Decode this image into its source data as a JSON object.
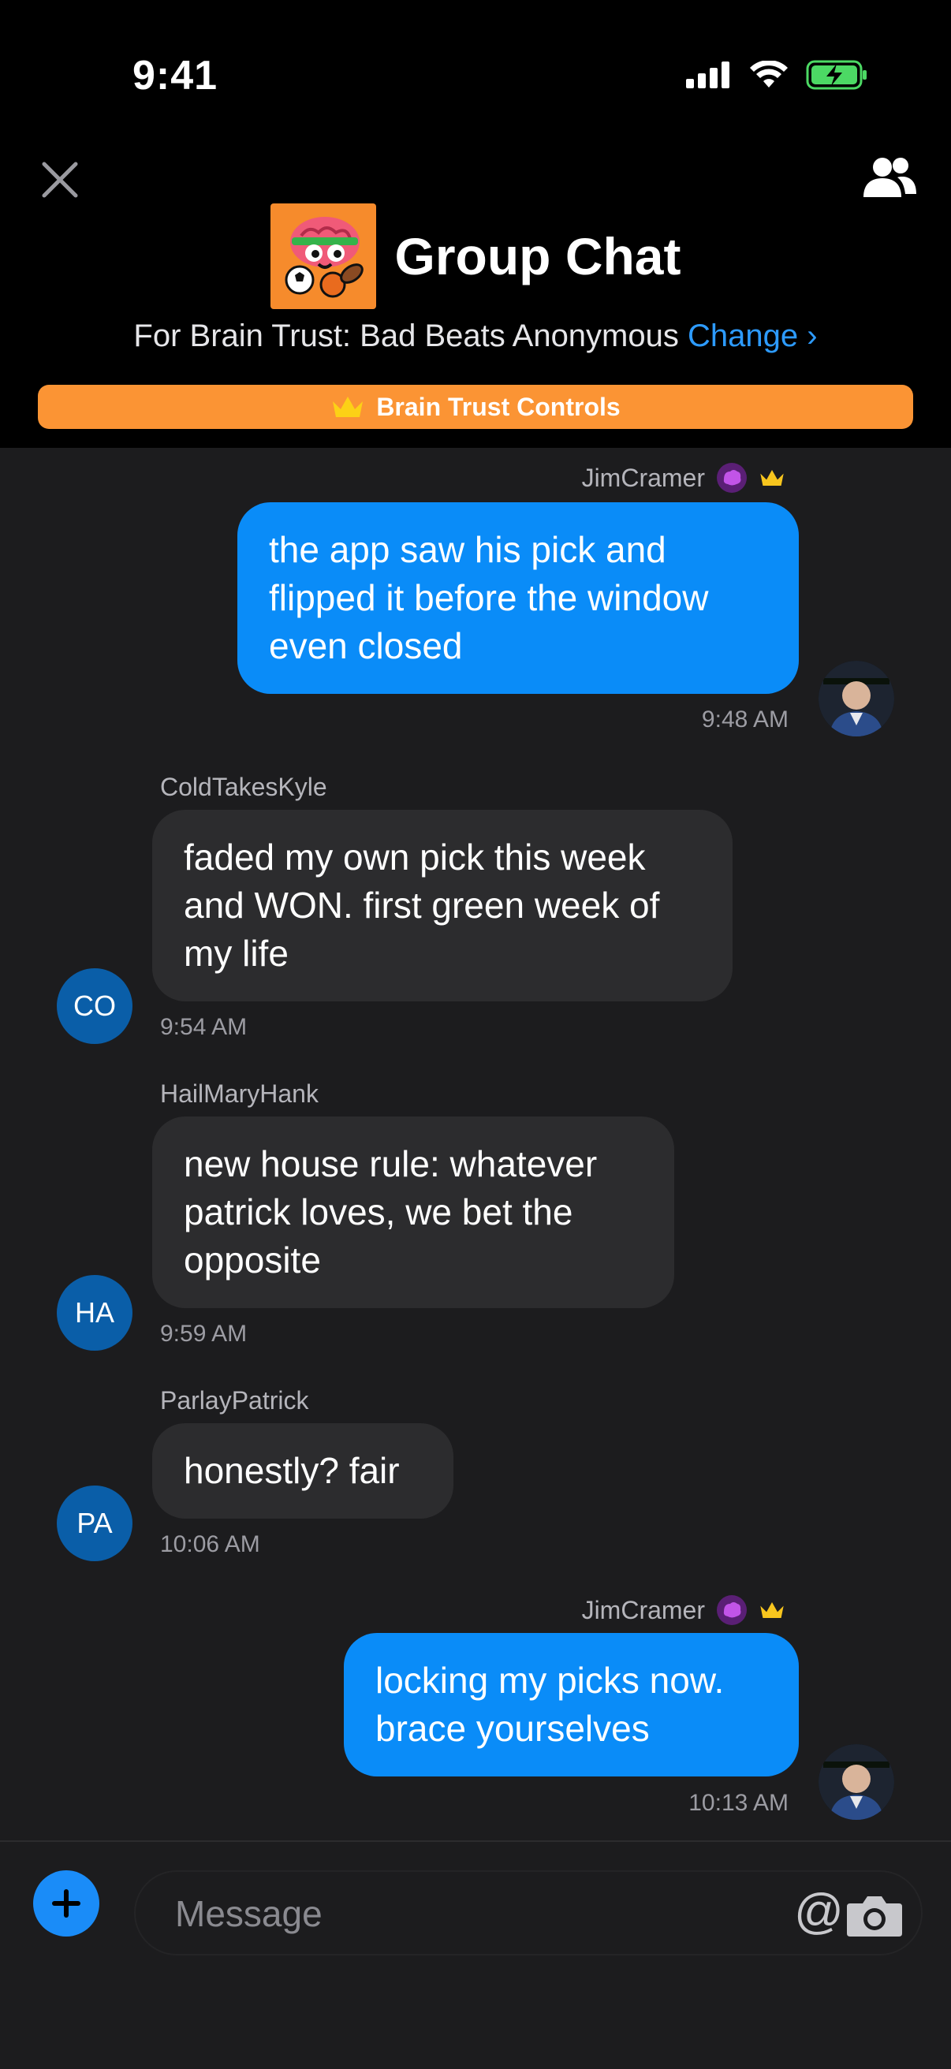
{
  "status_bar": {
    "time": "9:41"
  },
  "header": {
    "title": "Group Chat",
    "subtitle_prefix": "For Brain Trust: Bad Beats Anonymous",
    "change_label": "Change",
    "change_chevron": "›",
    "controls_label": "Brain Trust Controls"
  },
  "messages": [
    {
      "sender": "JimCramer",
      "text_lines": [
        "the app saw his pick and",
        "flipped it before the window",
        "even closed"
      ],
      "time": "9:48 AM",
      "mine": true
    },
    {
      "sender": "ColdTakesKyle",
      "initials": "CO",
      "text_lines": [
        "faded my own pick this week",
        "and WON. first green week of",
        "my life"
      ],
      "time": "9:54 AM",
      "mine": false
    },
    {
      "sender": "HailMaryHank",
      "initials": "HA",
      "text_lines": [
        "new house rule: whatever",
        "patrick loves, we bet the",
        "opposite"
      ],
      "time": "9:59 AM",
      "mine": false
    },
    {
      "sender": "ParlayPatrick",
      "initials": "PA",
      "text_lines": [
        "honestly? fair"
      ],
      "time": "10:06 AM",
      "mine": false
    },
    {
      "sender": "JimCramer",
      "text_lines": [
        "locking my picks now.",
        "brace yourselves"
      ],
      "time": "10:13 AM",
      "mine": true
    }
  ],
  "composer": {
    "placeholder": "Message",
    "at_symbol": "@"
  },
  "colors": {
    "accent_blue": "#0a8cf8",
    "controls_orange": "#fb9434",
    "brain_badge_purple": "#a93fd8",
    "crown_gold": "#f7c51e",
    "avatar_blue": "#0a5ea8"
  },
  "icons": [
    "close-icon",
    "people-icon",
    "brain-logo",
    "crown-icon",
    "brain-badge-icon",
    "plus-icon",
    "camera-icon",
    "signal-icon",
    "wifi-icon",
    "battery-charging-icon"
  ]
}
